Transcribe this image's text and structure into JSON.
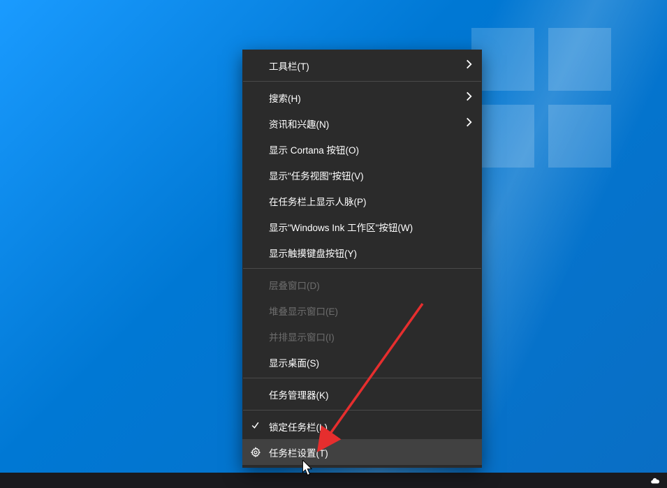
{
  "menu": {
    "toolbars": "工具栏(T)",
    "search": "搜索(H)",
    "news_interests": "资讯和兴趣(N)",
    "show_cortana": "显示 Cortana 按钮(O)",
    "show_taskview": "显示\"任务视图\"按钮(V)",
    "show_people": "在任务栏上显示人脉(P)",
    "show_ink": "显示\"Windows Ink 工作区\"按钮(W)",
    "show_touchkb": "显示触摸键盘按钮(Y)",
    "cascade": "层叠窗口(D)",
    "stacked": "堆叠显示窗口(E)",
    "sidebyside": "并排显示窗口(I)",
    "show_desktop": "显示桌面(S)",
    "task_manager": "任务管理器(K)",
    "lock_taskbar": "锁定任务栏(L)",
    "taskbar_settings": "任务栏设置(T)"
  }
}
